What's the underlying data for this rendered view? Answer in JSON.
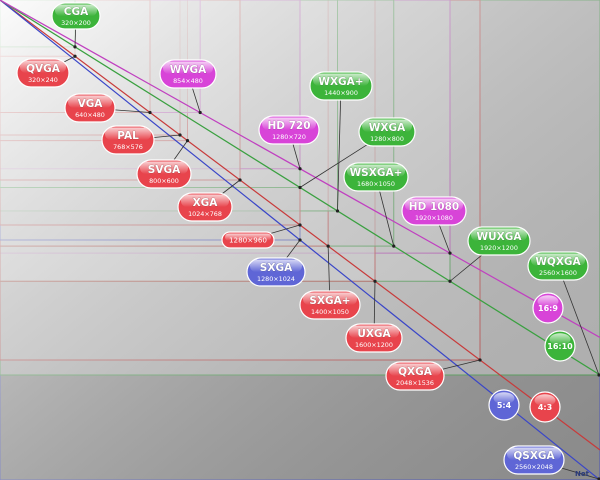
{
  "colors": {
    "red": "#e8444c",
    "green": "#3cb43a",
    "magenta": "#d844d8",
    "blue": "#5f66d6",
    "line_red": "#c83a3a",
    "line_green": "#3aa040",
    "line_magenta": "#c040c0",
    "line_blue": "#3a46c8"
  },
  "resolutions": [
    {
      "id": "cga",
      "name": "CGA",
      "dims": "320×200",
      "w": 320,
      "h": 200,
      "color": "green",
      "ratio": "16:10"
    },
    {
      "id": "qvga",
      "name": "QVGA",
      "dims": "320×240",
      "w": 320,
      "h": 240,
      "color": "red",
      "ratio": "4:3"
    },
    {
      "id": "wvga",
      "name": "WVGA",
      "dims": "854×480",
      "w": 854,
      "h": 480,
      "color": "magenta",
      "ratio": "16:9"
    },
    {
      "id": "vga",
      "name": "VGA",
      "dims": "640×480",
      "w": 640,
      "h": 480,
      "color": "red",
      "ratio": "4:3"
    },
    {
      "id": "pal",
      "name": "PAL",
      "dims": "768×576",
      "w": 768,
      "h": 576,
      "color": "red",
      "ratio": "4:3"
    },
    {
      "id": "svga",
      "name": "SVGA",
      "dims": "800×600",
      "w": 800,
      "h": 600,
      "color": "red",
      "ratio": "4:3"
    },
    {
      "id": "xga",
      "name": "XGA",
      "dims": "1024×768",
      "w": 1024,
      "h": 768,
      "color": "red",
      "ratio": "4:3"
    },
    {
      "id": "r1280x960",
      "name": "1280×960",
      "dims": "",
      "w": 1280,
      "h": 960,
      "color": "red",
      "ratio": "4:3"
    },
    {
      "id": "sxga",
      "name": "SXGA",
      "dims": "1280×1024",
      "w": 1280,
      "h": 1024,
      "color": "blue",
      "ratio": "5:4"
    },
    {
      "id": "sxgaplus",
      "name": "SXGA+",
      "dims": "1400×1050",
      "w": 1400,
      "h": 1050,
      "color": "red",
      "ratio": "4:3"
    },
    {
      "id": "uxga",
      "name": "UXGA",
      "dims": "1600×1200",
      "w": 1600,
      "h": 1200,
      "color": "red",
      "ratio": "4:3"
    },
    {
      "id": "qxga",
      "name": "QXGA",
      "dims": "2048×1536",
      "w": 2048,
      "h": 1536,
      "color": "red",
      "ratio": "4:3"
    },
    {
      "id": "hd720",
      "name": "HD 720",
      "dims": "1280×720",
      "w": 1280,
      "h": 720,
      "color": "magenta",
      "ratio": "16:9"
    },
    {
      "id": "wxgaplus",
      "name": "WXGA+",
      "dims": "1440×900",
      "w": 1440,
      "h": 900,
      "color": "green",
      "ratio": "16:10"
    },
    {
      "id": "wxga",
      "name": "WXGA",
      "dims": "1280×800",
      "w": 1280,
      "h": 800,
      "color": "green",
      "ratio": "16:10"
    },
    {
      "id": "wsxgaplus",
      "name": "WSXGA+",
      "dims": "1680×1050",
      "w": 1680,
      "h": 1050,
      "color": "green",
      "ratio": "16:10"
    },
    {
      "id": "hd1080",
      "name": "HD 1080",
      "dims": "1920×1080",
      "w": 1920,
      "h": 1080,
      "color": "magenta",
      "ratio": "16:9"
    },
    {
      "id": "wuxga",
      "name": "WUXGA",
      "dims": "1920×1200",
      "w": 1920,
      "h": 1200,
      "color": "green",
      "ratio": "16:10"
    },
    {
      "id": "wqxga",
      "name": "WQXGA",
      "dims": "2560×1600",
      "w": 2560,
      "h": 1600,
      "color": "green",
      "ratio": "16:10"
    },
    {
      "id": "qsxga",
      "name": "QSXGA",
      "dims": "2560×2048",
      "w": 2560,
      "h": 2048,
      "color": "blue",
      "ratio": "5:4"
    }
  ],
  "ratios": [
    {
      "id": "r16x9",
      "label": "16:9",
      "color": "magenta"
    },
    {
      "id": "r16x10",
      "label": "16:10",
      "color": "green"
    },
    {
      "id": "r5x4",
      "label": "5:4",
      "color": "blue"
    },
    {
      "id": "r4x3",
      "label": "4:3",
      "color": "red"
    }
  ],
  "watermark": "Net"
}
